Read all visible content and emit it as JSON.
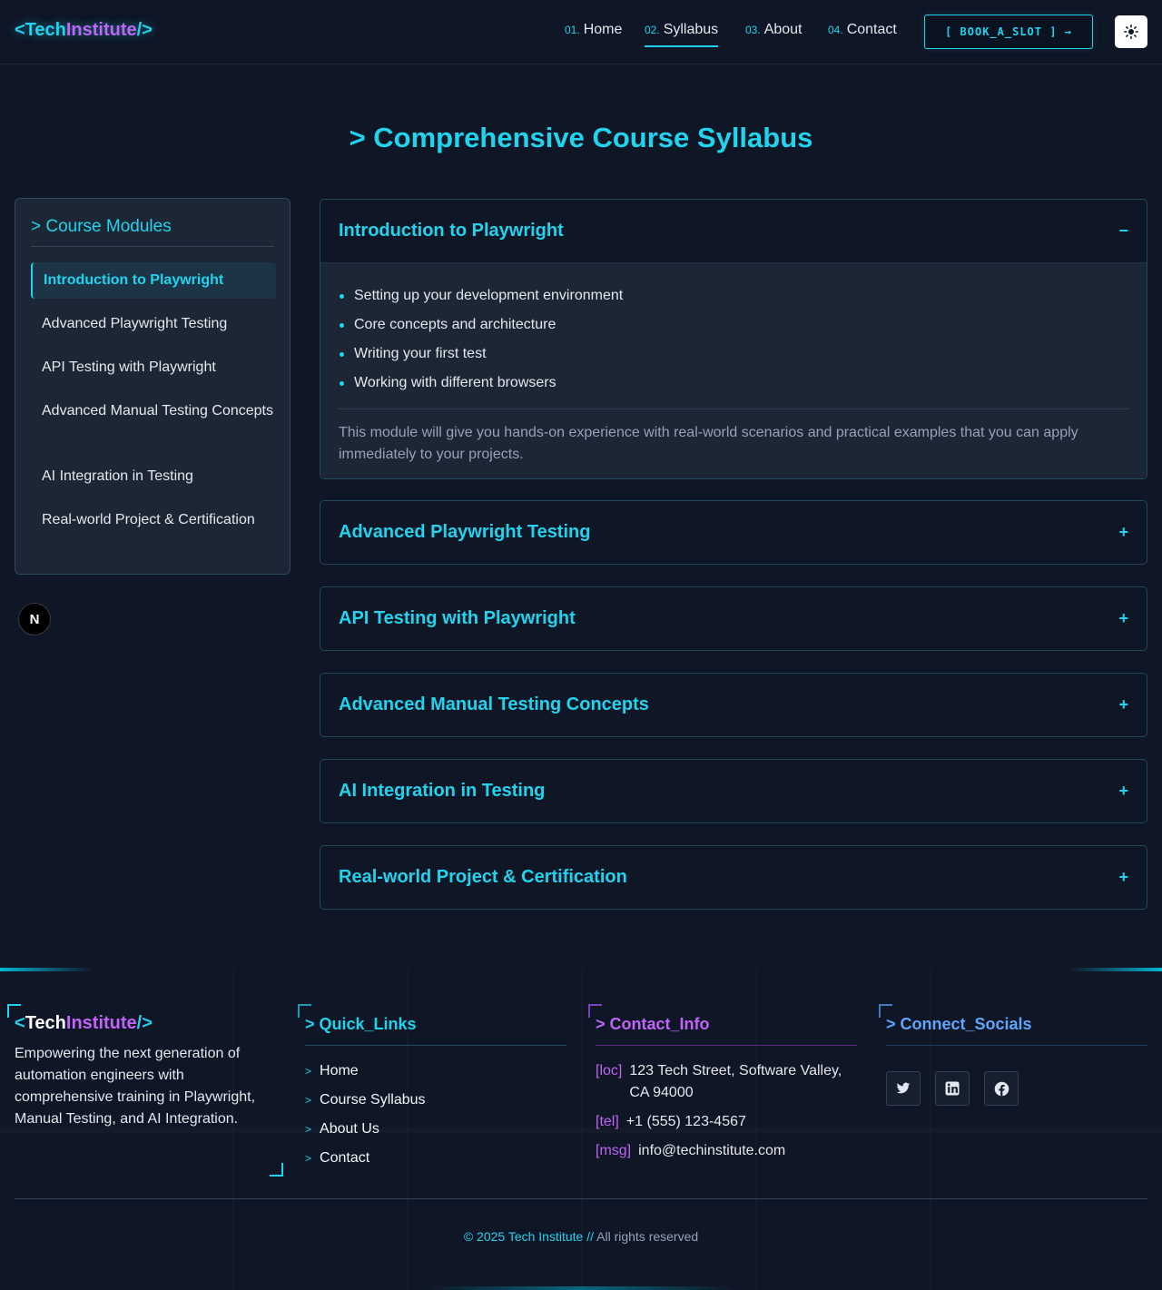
{
  "header": {
    "logo": {
      "open": "<Tech",
      "accent": "Institute",
      "close": "/>"
    },
    "nav": [
      {
        "num": "01.",
        "label": "Home"
      },
      {
        "num": "02.",
        "label": "Syllabus"
      },
      {
        "num": "03.",
        "label": "About"
      },
      {
        "num": "04.",
        "label": "Contact"
      }
    ],
    "book_button": "[ BOOK_A_SLOT ] →",
    "theme_icon": "sun-icon"
  },
  "main": {
    "title": "> Comprehensive Course Syllabus",
    "sidebar": {
      "title": "> Course Modules",
      "items": [
        "Introduction to Playwright",
        "Advanced Playwright Testing",
        "API Testing with Playwright",
        "Advanced Manual Testing Concepts",
        "AI Integration in Testing",
        "Real-world Project & Certification"
      ],
      "active_index": 0
    },
    "badge": "N",
    "modules": [
      {
        "title": "Introduction to Playwright",
        "toggle": "−",
        "topics": [
          "Setting up your development environment",
          "Core concepts and architecture",
          "Writing your first test",
          "Working with different browsers"
        ],
        "description": "This module will give you hands-on experience with real-world scenarios and practical examples that you can apply immediately to your projects."
      },
      {
        "title": "Advanced Playwright Testing",
        "toggle": "+"
      },
      {
        "title": "API Testing with Playwright",
        "toggle": "+"
      },
      {
        "title": "Advanced Manual Testing Concepts",
        "toggle": "+"
      },
      {
        "title": "AI Integration in Testing",
        "toggle": "+"
      },
      {
        "title": "Real-world Project & Certification",
        "toggle": "+"
      }
    ]
  },
  "footer": {
    "logo": {
      "open": "<",
      "tech": "Tech",
      "accent": "Institute",
      "close": "/>"
    },
    "about": "Empowering the next generation of automation engineers with comprehensive training in Playwright, Manual Testing, and AI Integration.",
    "quick_links": {
      "title": "> Quick_Links",
      "items": [
        "Home",
        "Course Syllabus",
        "About Us",
        "Contact"
      ]
    },
    "contact": {
      "title": "> Contact_Info",
      "items": [
        {
          "tag": "[loc]",
          "value": "123 Tech Street, Software Valley, CA 94000"
        },
        {
          "tag": "[tel]",
          "value": "+1 (555) 123-4567"
        },
        {
          "tag": "[msg]",
          "value": "info@techinstitute.com"
        }
      ]
    },
    "socials": {
      "title": "> Connect_Socials",
      "icons": [
        "twitter-icon",
        "linkedin-icon",
        "facebook-icon"
      ]
    },
    "copyright": {
      "prefix": "© 2025 ",
      "brand": "Tech Institute",
      "sep": " // ",
      "suffix": "All rights reserved"
    }
  },
  "colors": {
    "background": "#0f1626",
    "accent_cyan": "#22d3ee",
    "accent_purple": "#c065f5",
    "accent_blue": "#60a5fa",
    "card": "#1c2736"
  }
}
